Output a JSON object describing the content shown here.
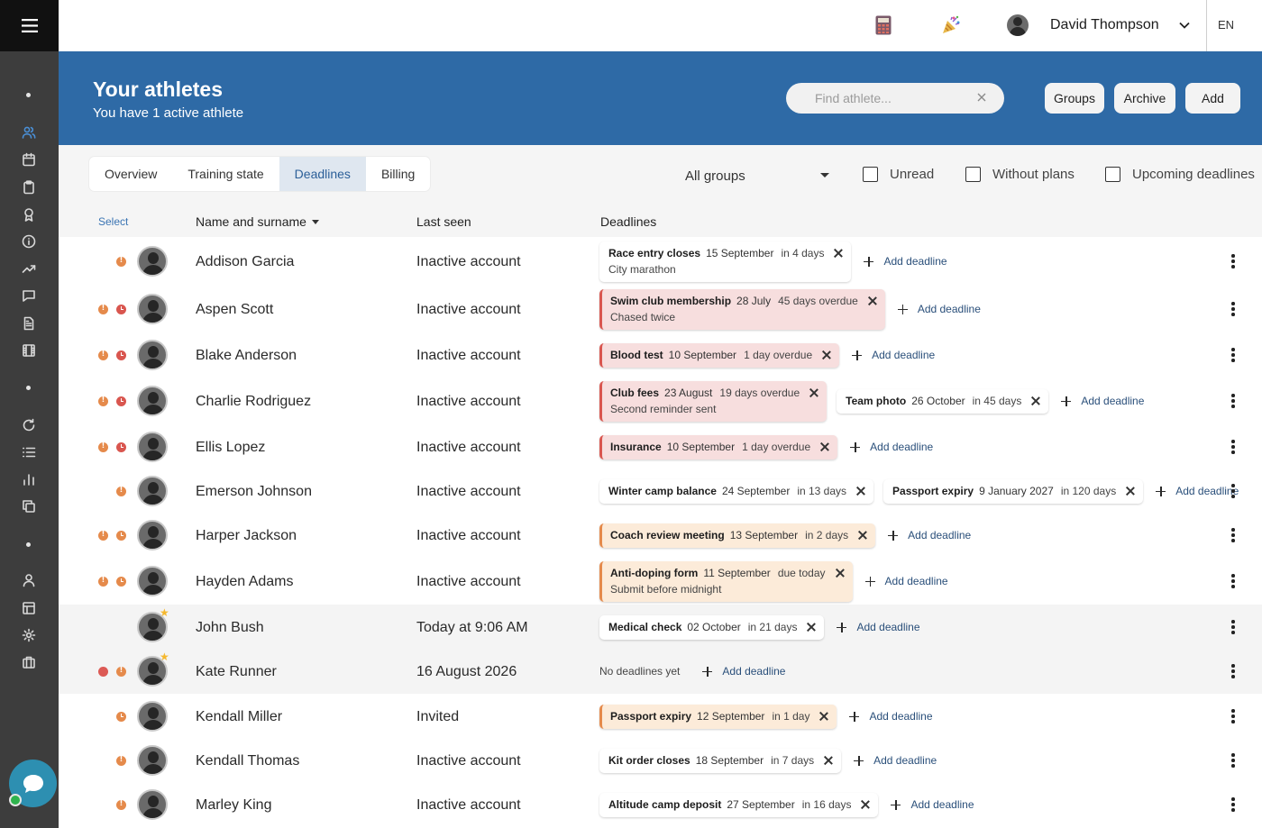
{
  "topbar": {
    "user_name": "David Thompson",
    "language": "EN",
    "icons": [
      "calculator-icon",
      "party-popper-icon"
    ]
  },
  "sidebar": {
    "icons": [
      "users-icon",
      "calendar-icon",
      "clipboard-icon",
      "award-icon",
      "info-icon",
      "trending-up-icon",
      "message-icon",
      "document-icon",
      "film-icon",
      "refresh-icon",
      "list-icon",
      "bar-chart-icon",
      "copy-icon",
      "user-icon",
      "layout-icon",
      "settings-icon",
      "briefcase-icon"
    ],
    "active": "users-icon",
    "chat_status_color": "#2fb34d"
  },
  "header": {
    "title": "Your athletes",
    "subtitle": "You have 1 active athlete",
    "search_placeholder": "Find athlete...",
    "buttons": {
      "groups": "Groups",
      "archive": "Archive",
      "add": "Add"
    },
    "background": "#2e6aa6"
  },
  "filters": {
    "tabs": [
      "Overview",
      "Training state",
      "Deadlines",
      "Billing"
    ],
    "active_tab": "Deadlines",
    "group_select": "All groups",
    "checkboxes": [
      "Unread",
      "Without plans",
      "Upcoming deadlines"
    ]
  },
  "table": {
    "columns": {
      "select": "Select",
      "name": "Name and surname",
      "last_seen": "Last seen",
      "deadlines": "Deadlines"
    },
    "add_deadline_label": "Add deadline",
    "no_deadlines_label": "No deadlines yet",
    "rows": [
      {
        "name": "Addison Garcia",
        "last_seen": "Inactive account",
        "indicators": [
          "warn"
        ],
        "deadlines": [
          {
            "title": "Race entry closes",
            "date": "15 September",
            "relative": "in 4 days",
            "note": "City marathon",
            "status": "normal"
          }
        ]
      },
      {
        "name": "Aspen Scott",
        "last_seen": "Inactive account",
        "indicators": [
          "warn",
          "clock-red"
        ],
        "deadlines": [
          {
            "title": "Swim club membership",
            "date": "28 July",
            "relative": "45 days overdue",
            "note": "Chased twice",
            "status": "overdue"
          }
        ]
      },
      {
        "name": "Blake Anderson",
        "last_seen": "Inactive account",
        "indicators": [
          "warn",
          "clock-red"
        ],
        "deadlines": [
          {
            "title": "Blood test",
            "date": "10 September",
            "relative": "1 day overdue",
            "note": "",
            "status": "overdue"
          }
        ]
      },
      {
        "name": "Charlie Rodriguez",
        "last_seen": "Inactive account",
        "indicators": [
          "warn",
          "clock-red"
        ],
        "deadlines": [
          {
            "title": "Club fees",
            "date": "23 August",
            "relative": "19 days overdue",
            "note": "Second reminder sent",
            "status": "overdue"
          },
          {
            "title": "Team photo",
            "date": "26 October",
            "relative": "in 45 days",
            "note": "",
            "status": "normal"
          }
        ]
      },
      {
        "name": "Ellis Lopez",
        "last_seen": "Inactive account",
        "indicators": [
          "warn",
          "clock-red"
        ],
        "deadlines": [
          {
            "title": "Insurance",
            "date": "10 September",
            "relative": "1 day overdue",
            "note": "",
            "status": "overdue"
          }
        ]
      },
      {
        "name": "Emerson Johnson",
        "last_seen": "Inactive account",
        "indicators": [
          "warn"
        ],
        "deadlines": [
          {
            "title": "Winter camp balance",
            "date": "24 September",
            "relative": "in 13 days",
            "note": "",
            "status": "normal"
          },
          {
            "title": "Passport expiry",
            "date": "9 January 2027",
            "relative": "in 120 days",
            "note": "",
            "status": "normal"
          }
        ]
      },
      {
        "name": "Harper Jackson",
        "last_seen": "Inactive account",
        "indicators": [
          "warn",
          "clock-orange"
        ],
        "deadlines": [
          {
            "title": "Coach review meeting",
            "date": "13 September",
            "relative": "in 2 days",
            "note": "",
            "status": "soon"
          }
        ]
      },
      {
        "name": "Hayden Adams",
        "last_seen": "Inactive account",
        "indicators": [
          "warn",
          "clock-orange"
        ],
        "deadlines": [
          {
            "title": "Anti-doping form",
            "date": "11 September",
            "relative": "due today",
            "note": "Submit before midnight",
            "status": "soon"
          }
        ]
      },
      {
        "name": "John Bush",
        "last_seen": "Today at 9:06 AM",
        "indicators": [],
        "starred": true,
        "highlight": true,
        "deadlines": [
          {
            "title": "Medical check",
            "date": "02 October",
            "relative": "in 21 days",
            "note": "",
            "status": "normal"
          }
        ]
      },
      {
        "name": "Kate Runner",
        "last_seen": "16 August 2026",
        "indicators": [
          "dot-red",
          "warn"
        ],
        "starred": true,
        "highlight": true,
        "deadlines": []
      },
      {
        "name": "Kendall Miller",
        "last_seen": "Invited",
        "indicators": [
          "clock-orange"
        ],
        "deadlines": [
          {
            "title": "Passport expiry",
            "date": "12 September",
            "relative": "in 1 day",
            "note": "",
            "status": "soon"
          }
        ]
      },
      {
        "name": "Kendall Thomas",
        "last_seen": "Inactive account",
        "indicators": [
          "warn"
        ],
        "deadlines": [
          {
            "title": "Kit order closes",
            "date": "18 September",
            "relative": "in 7 days",
            "note": "",
            "status": "normal"
          }
        ]
      },
      {
        "name": "Marley King",
        "last_seen": "Inactive account",
        "indicators": [
          "warn"
        ],
        "deadlines": [
          {
            "title": "Altitude camp deposit",
            "date": "27 September",
            "relative": "in 16 days",
            "note": "",
            "status": "normal"
          }
        ]
      }
    ]
  }
}
